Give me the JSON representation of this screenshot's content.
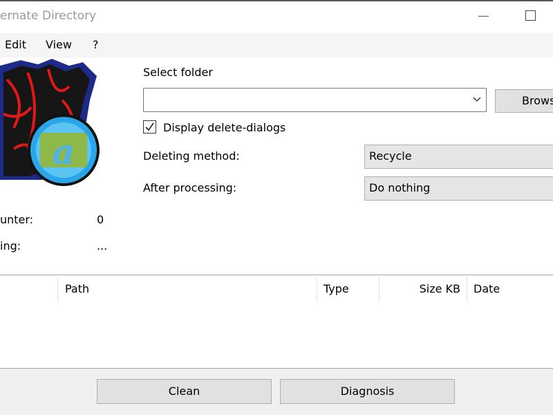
{
  "window": {
    "title": "ernate Directory",
    "minimize_icon": "minimize-icon",
    "maximize_icon": "maximize-icon"
  },
  "menu": [
    "Edit",
    "View",
    "?"
  ],
  "form": {
    "select_folder_label": "Select folder",
    "folder_value": "",
    "browse_label": "Browse",
    "display_delete_dialogs_label": "Display delete-dialogs",
    "display_delete_dialogs_checked": true,
    "deleting_method_label": "Deleting method:",
    "deleting_method_value": "Recycle",
    "after_processing_label": "After processing:",
    "after_processing_value": "Do nothing"
  },
  "stats": [
    {
      "label": "unter:",
      "value": "0"
    },
    {
      "label": "ing:",
      "value": "..."
    }
  ],
  "list": {
    "columns": [
      "",
      "Path",
      "Type",
      "Size KB",
      "Date"
    ],
    "rows": []
  },
  "actions": {
    "clean_label": "Clean",
    "diagnosis_label": "Diagnosis"
  }
}
